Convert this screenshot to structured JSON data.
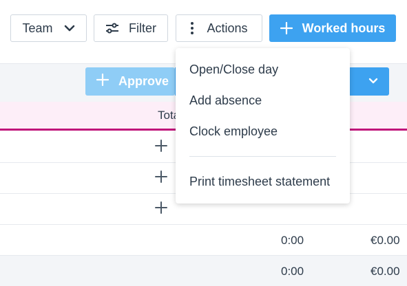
{
  "toolbar": {
    "team_label": "Team",
    "filter_label": "Filter",
    "actions_label": "Actions",
    "worked_hours_label": "Worked hours"
  },
  "subheader": {
    "approve_label": "Approve"
  },
  "table": {
    "header_total": "Total",
    "rows": [
      {
        "time": "",
        "amount": ""
      },
      {
        "time": "",
        "amount": ""
      },
      {
        "time": "",
        "amount": ""
      },
      {
        "time": "0:00",
        "amount": "€0.00"
      },
      {
        "time": "0:00",
        "amount": "€0.00"
      }
    ]
  },
  "actions_menu": {
    "items": [
      "Open/Close day",
      "Add absence",
      "Clock employee",
      "Print timesheet statement"
    ]
  },
  "colors": {
    "primary": "#3da2f0",
    "primary_disabled": "#8fcdf6",
    "accent_line": "#c0137a",
    "header_bg": "#fdeef8"
  },
  "icons": {
    "team_chevron": "chevron-down-icon",
    "filter": "sliders-icon",
    "actions": "kebab-icon",
    "worked_hours": "plus-icon"
  }
}
